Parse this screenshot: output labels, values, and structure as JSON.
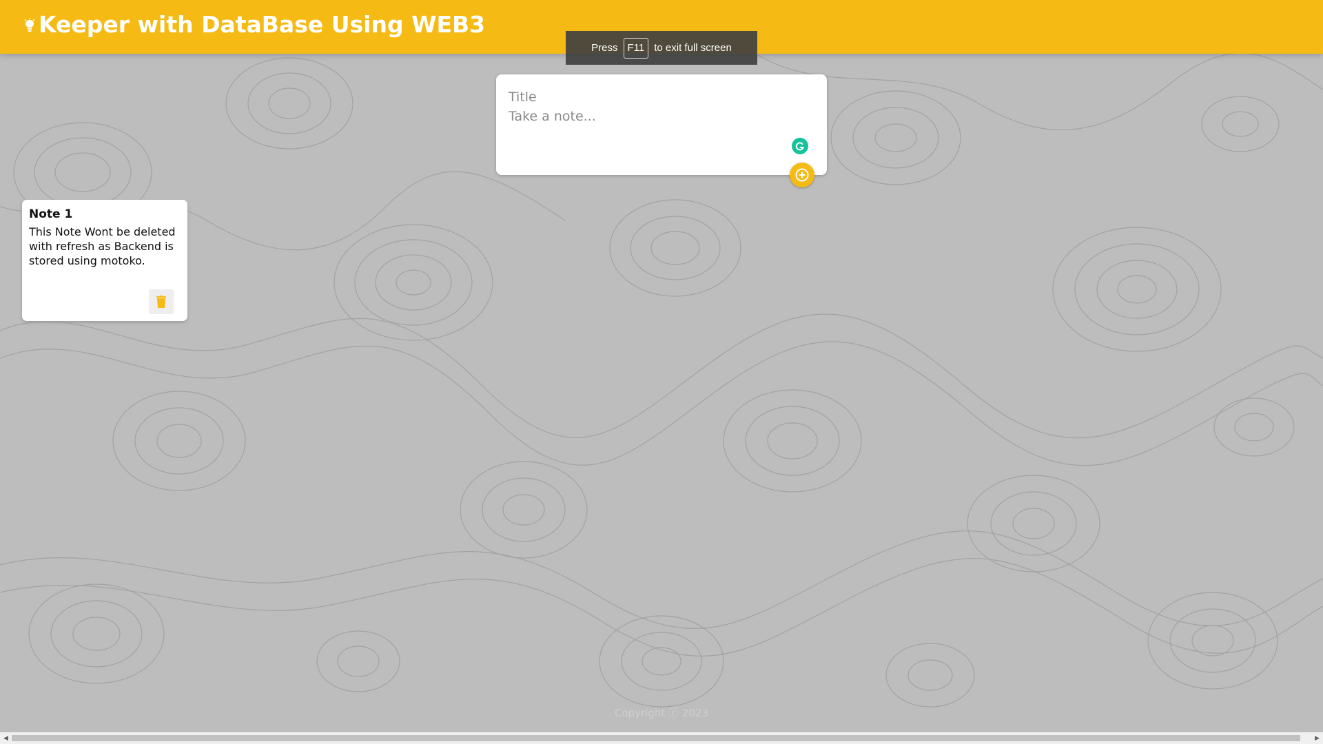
{
  "colors": {
    "header": "#f5ba13",
    "accent": "#f5ba13",
    "background": "#bdbdbd",
    "grammarly": "#15c39a"
  },
  "header": {
    "title": "Keeper with DataBase Using WEB3",
    "icon": "lightbulb-icon"
  },
  "fullscreen_banner": {
    "press": "Press",
    "key": "F11",
    "suffix": "to exit full screen"
  },
  "create_note": {
    "title_placeholder": "Title",
    "content_placeholder": "Take a note...",
    "add_icon": "plus-circle-icon",
    "grammarly_icon": "grammarly-icon"
  },
  "notes": [
    {
      "title": "Note 1",
      "content": "This Note Wont be deleted with refresh as Backend is stored using motoko.",
      "delete_icon": "trash-icon"
    }
  ],
  "footer": {
    "text": "Copyright ⓒ 2023"
  }
}
